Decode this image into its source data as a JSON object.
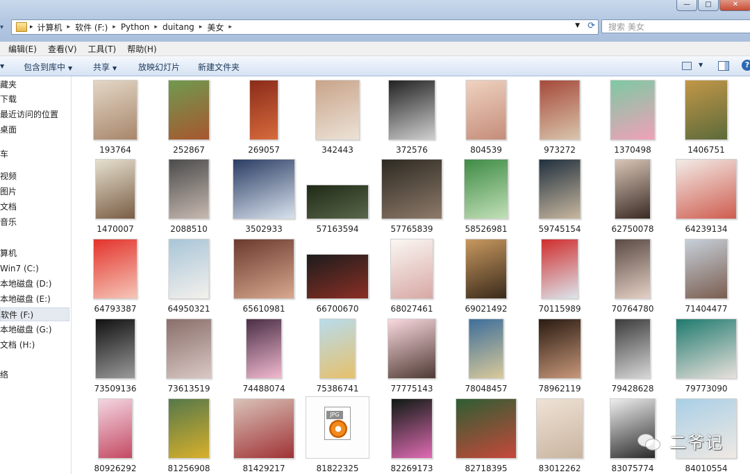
{
  "window": {
    "buttons": [
      "—",
      "□",
      "✕"
    ]
  },
  "address_bar": {
    "breadcrumbs": [
      "计算机",
      "软件 (F:)",
      "Python",
      "duitang",
      "美女"
    ]
  },
  "search": {
    "placeholder": "搜索 美女"
  },
  "menu": [
    "编辑(E)",
    "查看(V)",
    "工具(T)",
    "帮助(H)"
  ],
  "toolbar": {
    "include_library": "包含到库中",
    "share": "共享",
    "slideshow": "放映幻灯片",
    "new_folder": "新建文件夹",
    "help_glyph": "?"
  },
  "nav": [
    "藏夹",
    "下载",
    "最近访问的位置",
    "桌面",
    "车",
    "视频",
    "图片",
    "文档",
    "音乐",
    "算机",
    "Win7 (C:)",
    "本地磁盘 (D:)",
    "本地磁盘 (E:)",
    "软件 (F:)",
    "本地磁盘 (G:)",
    "文档 (H:)",
    "络"
  ],
  "files": [
    "193764",
    "252867",
    "269057",
    "342443",
    "372576",
    "804539",
    "973272",
    "1370498",
    "1406751",
    "1470007",
    "2088510",
    "3502933",
    "57163594",
    "57765839",
    "58526981",
    "59745154",
    "62750078",
    "64239134",
    "64793387",
    "64950321",
    "65610981",
    "66700670",
    "68027461",
    "69021492",
    "70115989",
    "70764780",
    "71404477",
    "73509136",
    "73613519",
    "74488074",
    "75386741",
    "77775143",
    "78048457",
    "78962119",
    "79428628",
    "79773090",
    "80926292",
    "81256908",
    "81429217",
    "81822325",
    "82269173",
    "82718395",
    "83012262",
    "83075774",
    "84010554"
  ],
  "jpg_badge": "JPG",
  "watermark": {
    "text": "二爷记"
  }
}
